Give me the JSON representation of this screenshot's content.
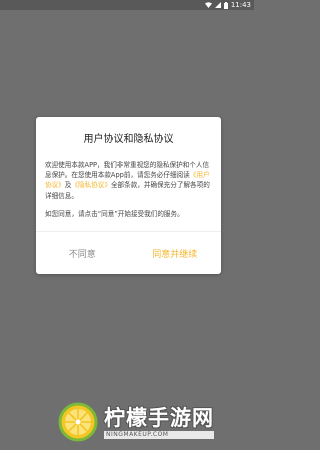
{
  "status_bar": {
    "time": "11:43"
  },
  "dialog": {
    "title": "用户协议和隐私协议",
    "p1_before": "欢迎使用本款APP，我们非常重视您的隐私保护和个人信息保护。在您使用本款App前，请您务必仔细阅读",
    "p1_link1": "《用户协议》",
    "p1_and": "及",
    "p1_link2": "《隐私协议》",
    "p1_after": "全部条款，并确保充分了解各项的详细信息。",
    "p2": "如您同意，请点击“同意”开始接受我们的服务。",
    "disagree_label": "不同意",
    "agree_label": "同意并继续"
  },
  "watermark": {
    "name": "柠檬手游网",
    "url": "NINGMAKEUP.COM"
  },
  "colors": {
    "accent": "#f5b62c",
    "overlay": "#6f6f6f",
    "status_bar": "#595959"
  },
  "icons": [
    "wifi-icon",
    "signal-icon",
    "battery-icon",
    "lemon-logo-icon"
  ]
}
